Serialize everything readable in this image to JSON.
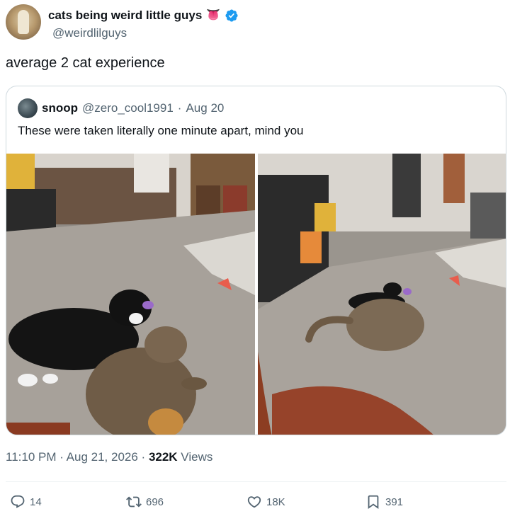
{
  "author": {
    "display_name": "cats being weird little guys",
    "emoji": "👅",
    "handle": "@weirdlilguys"
  },
  "tweet": {
    "text": "average 2 cat experience",
    "timestamp": "11:10 PM · Aug 21, 2026 · ",
    "views_count": "322K",
    "views_label": " Views"
  },
  "quote": {
    "name": "snoop",
    "handle": "@zero_cool1991",
    "separator": "·",
    "date": "Aug 20",
    "text": "These were taken literally one minute apart, mind you"
  },
  "actions": {
    "replies": "14",
    "reposts": "696",
    "likes": "18K",
    "bookmarks": "391"
  },
  "icons": {
    "verified": "verified-badge-icon",
    "reply": "reply-icon",
    "repost": "repost-icon",
    "like": "heart-icon",
    "bookmark": "bookmark-icon"
  },
  "colors": {
    "verified": "#1d9bf0",
    "secondary_text": "#536471",
    "border": "#cfd9de"
  }
}
